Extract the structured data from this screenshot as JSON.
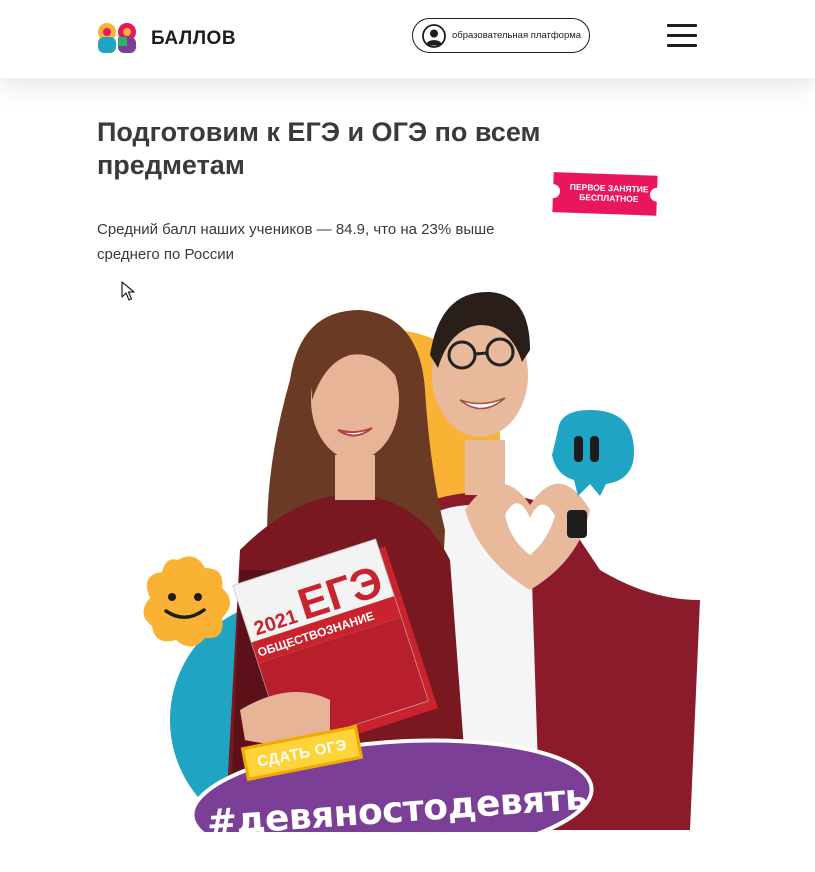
{
  "header": {
    "logo_text": "БАЛЛОВ",
    "platform_button_label": "образовательная платформа"
  },
  "hero": {
    "title": "Подготовим к ЕГЭ и ОГЭ по всем предметам",
    "subtitle": "Средний балл наших учеников — 84.9, что на 23% выше среднего по России",
    "promo_ticket": "ПЕРВОЕ ЗАНЯТИЕ\nБЕСПЛАТНОЕ",
    "book_label_year": "2021",
    "book_label_exam": "ЕГЭ",
    "book_label_subject": "ОБЩЕСТВОЗНАНИЕ",
    "sticker_oge": "СДАТЬ ОГЭ",
    "hashtag": "#девяностодевять"
  },
  "colors": {
    "brand_pink": "#e8175d",
    "brand_yellow": "#f9b233",
    "brand_blue": "#1fa4c4",
    "brand_purple": "#7b3f98",
    "text_dark": "#3a3a3a"
  },
  "icons": [
    "logo-99-icon",
    "user-avatar-icon",
    "hamburger-menu-icon",
    "cursor-icon"
  ]
}
